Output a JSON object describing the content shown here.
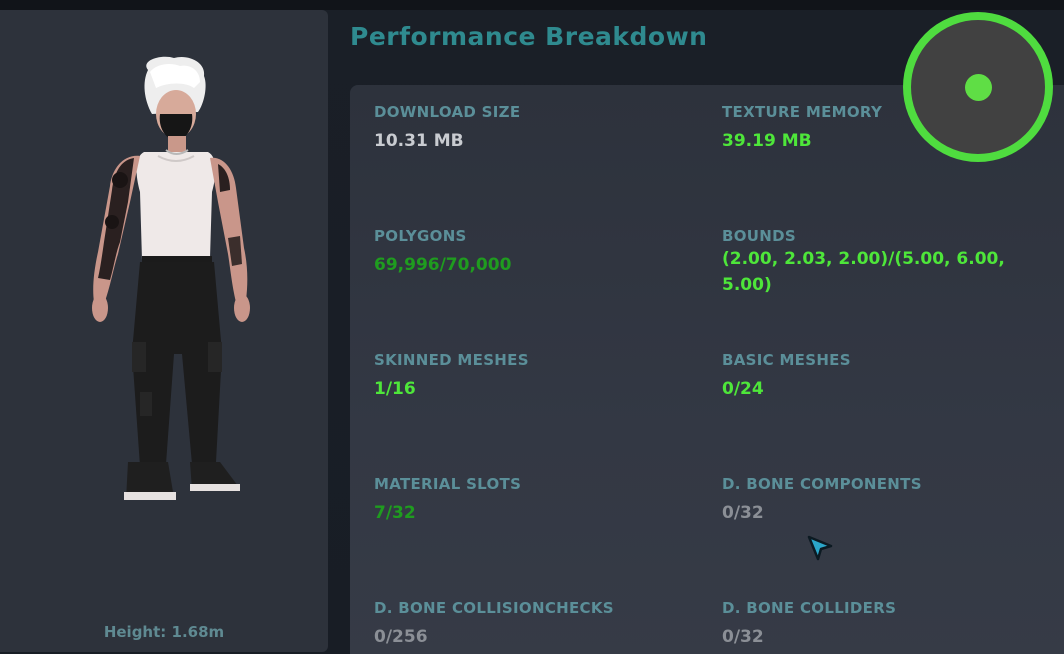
{
  "page": {
    "title": "Performance Breakdown"
  },
  "avatar": {
    "height_label": "Height: 1.68m"
  },
  "stats": [
    {
      "label": "DOWNLOAD SIZE",
      "value": "10.31 MB",
      "color": "#c9ccd1"
    },
    {
      "label": "TEXTURE MEMORY",
      "value": "39.19 MB",
      "color": "#4ee63a"
    },
    {
      "label": "POLYGONS",
      "value": "69,996/70,000",
      "color": "#1f9c1f"
    },
    {
      "label": "BOUNDS",
      "value": "(2.00, 2.03, 2.00)/(5.00, 6.00, 5.00)",
      "color": "#4ee63a"
    },
    {
      "label": "SKINNED MESHES",
      "value": "1/16",
      "color": "#4ee63a"
    },
    {
      "label": "BASIC MESHES",
      "value": "0/24",
      "color": "#4ee63a"
    },
    {
      "label": "MATERIAL SLOTS",
      "value": "7/32",
      "color": "#1f9c1f"
    },
    {
      "label": "D. BONE COMPONENTS",
      "value": "0/32",
      "color": "#8b8f96"
    },
    {
      "label": "D. BONE COLLISIONCHECKS",
      "value": "0/256",
      "color": "#8b8f96"
    },
    {
      "label": "D. BONE COLLIDERS",
      "value": "0/32",
      "color": "#8b8f96"
    }
  ],
  "controls": {
    "record_button_icon": "record-icon",
    "accent_color": "#4fdc3f"
  },
  "cursor": {
    "icon": "arrow-cursor-icon",
    "color": "#2ba6c9"
  }
}
